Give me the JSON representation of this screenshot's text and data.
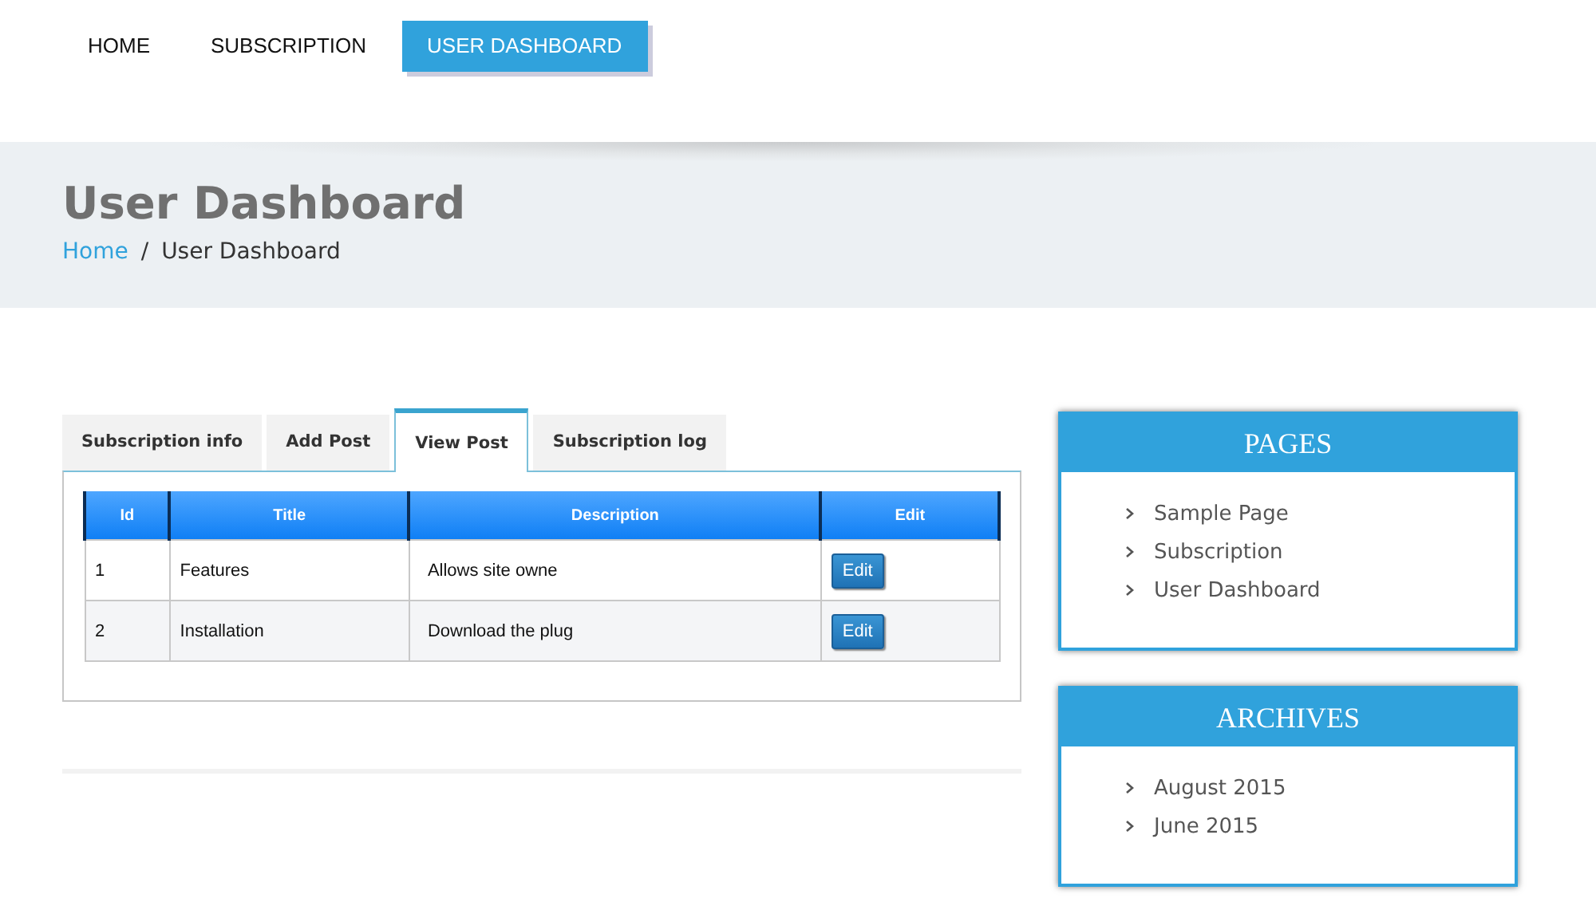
{
  "nav": [
    {
      "label": "HOME",
      "selected": false
    },
    {
      "label": "SUBSCRIPTION",
      "selected": false
    },
    {
      "label": "USER DASHBOARD",
      "selected": true
    }
  ],
  "banner": {
    "title": "User Dashboard",
    "breadcrumb": [
      {
        "label": "Home",
        "kind": "link"
      },
      {
        "label": "User Dashboard",
        "kind": "current"
      }
    ],
    "separator": "/"
  },
  "tabs": [
    {
      "label": "Subscription info",
      "selected": false
    },
    {
      "label": "Add Post",
      "selected": false
    },
    {
      "label": "View Post",
      "selected": true
    },
    {
      "label": "Subscription log",
      "selected": false
    }
  ],
  "table": {
    "columns": [
      "Id",
      "Title",
      "Description",
      "Edit"
    ],
    "rows": [
      {
        "id": "1",
        "title": "Features",
        "description": "Allows site owne",
        "action": "Edit"
      },
      {
        "id": "2",
        "title": "Installation",
        "description": "Download the plug",
        "action": "Edit"
      }
    ]
  },
  "widgets": [
    {
      "title": "PAGES",
      "items": [
        "Sample Page",
        "Subscription",
        "User Dashboard"
      ]
    },
    {
      "title": "ARCHIVES",
      "items": [
        "August 2015",
        "June 2015"
      ]
    }
  ]
}
